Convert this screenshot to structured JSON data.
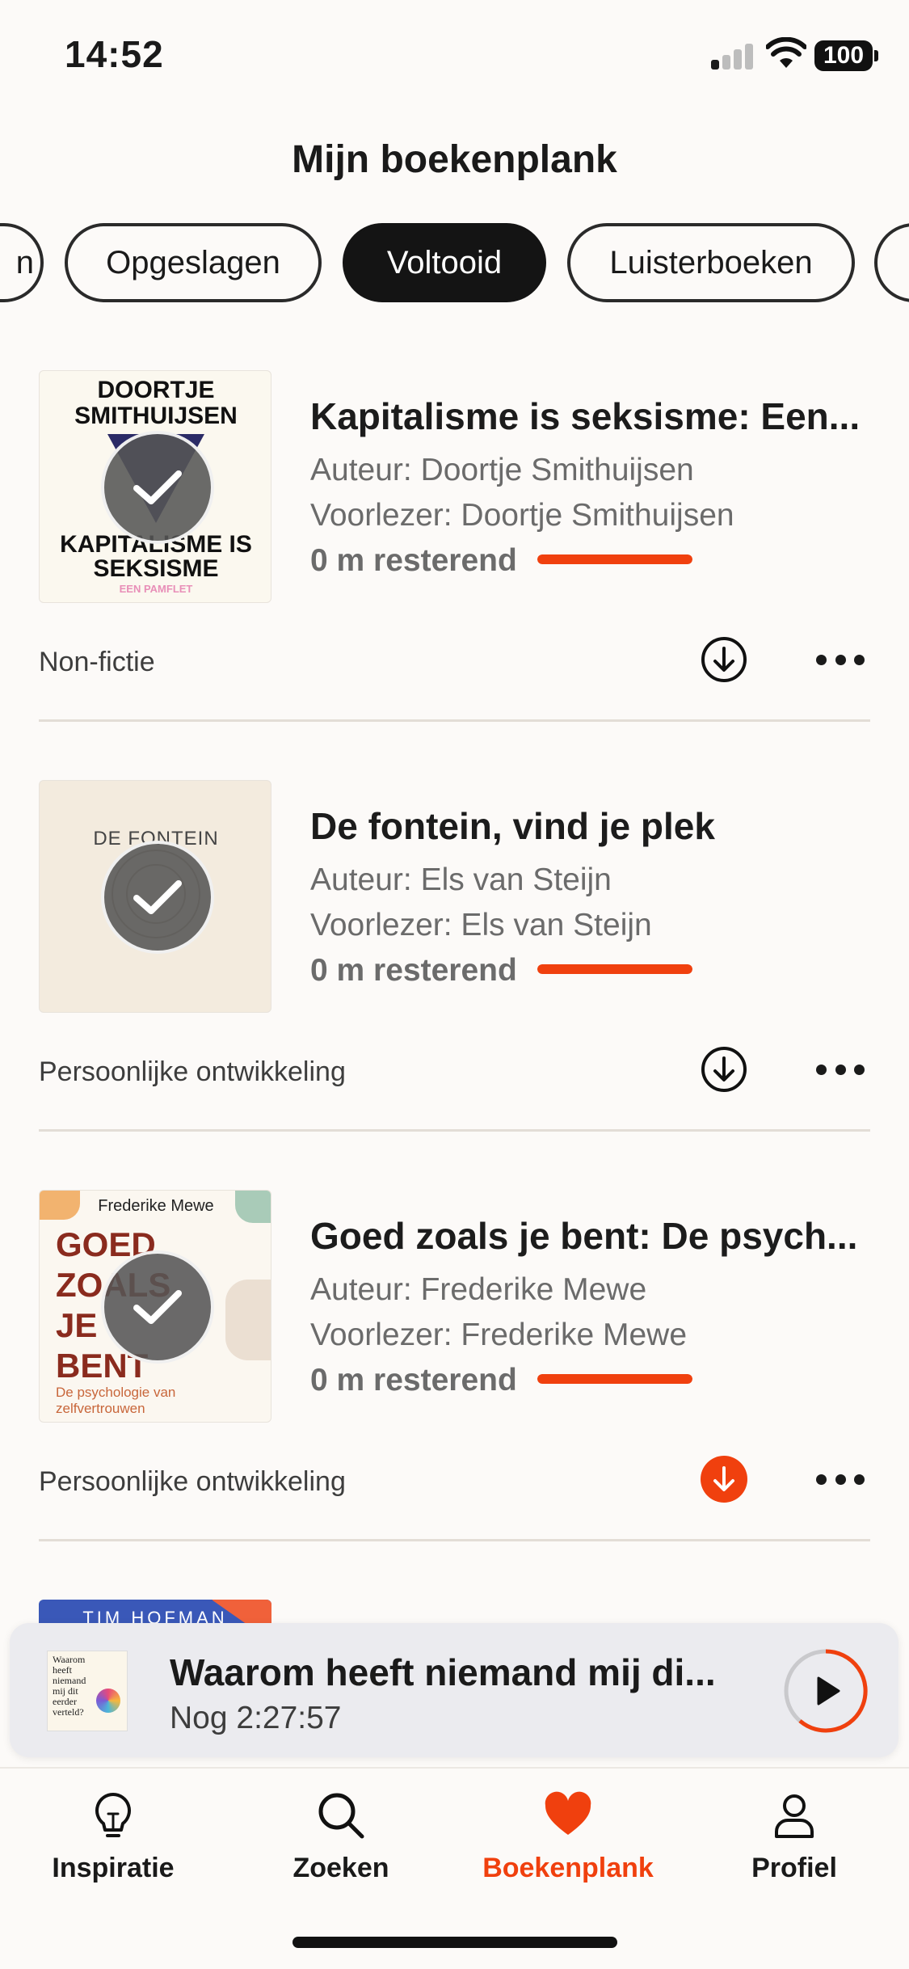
{
  "status_bar": {
    "time": "14:52",
    "battery": "100"
  },
  "header": {
    "title": "Mijn boekenplank"
  },
  "filters": [
    {
      "label": "n",
      "active": false
    },
    {
      "label": "Opgeslagen",
      "active": false
    },
    {
      "label": "Voltooid",
      "active": true
    },
    {
      "label": "Luisterboeken",
      "active": false
    },
    {
      "label": "",
      "active": false
    }
  ],
  "books": [
    {
      "title": "Kapitalisme is seksisme: Een...",
      "author": "Auteur: Doortje Smithuijsen",
      "narrator": "Voorlezer: Doortje Smithuijsen",
      "remaining": "0 m resterend",
      "progress": 1.0,
      "genre": "Non-fictie",
      "downloaded": false,
      "cover": {
        "top": "DOORTJE SMITHUIJSEN",
        "bottom": "KAPITALISME IS SEKSISME",
        "tag": "EEN PAMFLET"
      }
    },
    {
      "title": "De fontein, vind je plek",
      "author": "Auteur: Els van Steijn",
      "narrator": "Voorlezer: Els van Steijn",
      "remaining": "0 m resterend",
      "progress": 1.0,
      "genre": "Persoonlijke ontwikkeling",
      "downloaded": false,
      "cover": {
        "top": "DE FONTEIN"
      }
    },
    {
      "title": "Goed zoals je bent: De psych...",
      "author": "Auteur: Frederike Mewe",
      "narrator": "Voorlezer: Frederike Mewe",
      "remaining": "0 m resterend",
      "progress": 1.0,
      "genre": "Persoonlijke ontwikkeling",
      "downloaded": true,
      "cover": {
        "author": "Frederike Mewe",
        "title": "GOED ZOALS JE BENT",
        "subtitle": "De psychologie van zelfvertrouwen"
      }
    },
    {
      "cover": {
        "author": "TIM HOFMAN"
      }
    }
  ],
  "mini_player": {
    "title": "Waarom heeft niemand mij di...",
    "subtitle": "Nog 2:27:57",
    "cover_text": "Waarom heeft niemand mij dit eerder verteld?"
  },
  "tabs": [
    {
      "label": "Inspiratie",
      "icon": "lightbulb-icon",
      "active": false
    },
    {
      "label": "Zoeken",
      "icon": "search-icon",
      "active": false
    },
    {
      "label": "Boekenplank",
      "icon": "heart-icon",
      "active": true
    },
    {
      "label": "Profiel",
      "icon": "profile-icon",
      "active": false
    }
  ],
  "colors": {
    "accent": "#f0400e",
    "background": "#fcfaf8",
    "chip_active": "#141414"
  }
}
